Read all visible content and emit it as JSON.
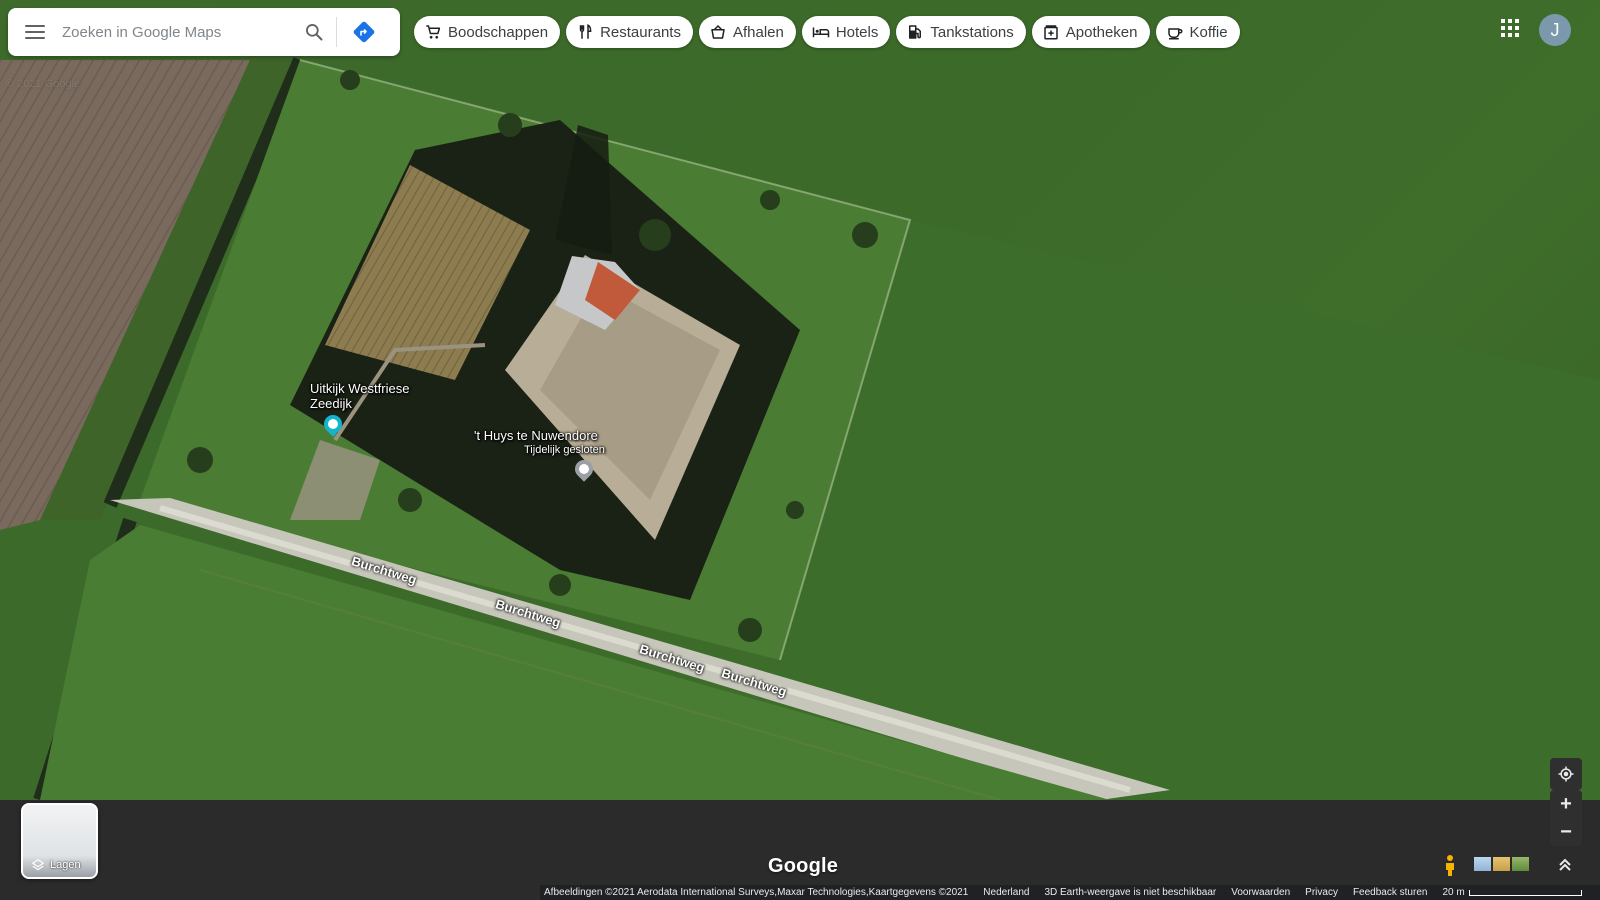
{
  "search": {
    "placeholder": "Zoeken in Google Maps",
    "menu_icon": "hamburger-menu-icon",
    "search_icon": "magnifier-icon",
    "directions_icon": "directions-diamond-icon",
    "accent_color": "#1a73e8"
  },
  "categories": [
    {
      "label": "Boodschappen",
      "icon": "shopping-cart-icon"
    },
    {
      "label": "Restaurants",
      "icon": "fork-knife-icon"
    },
    {
      "label": "Afhalen",
      "icon": "takeout-bag-icon"
    },
    {
      "label": "Hotels",
      "icon": "bed-icon"
    },
    {
      "label": "Tankstations",
      "icon": "fuel-pump-icon"
    },
    {
      "label": "Apotheken",
      "icon": "pharmacy-icon"
    },
    {
      "label": "Koffie",
      "icon": "coffee-cup-icon"
    }
  ],
  "account": {
    "initial": "J",
    "avatar_color": "#7b98ac"
  },
  "map": {
    "watermark": "© 2021 Google",
    "places": [
      {
        "name": "Uitkijk Westfriese Zeedijk",
        "name_line1": "Uitkijk Westfriese",
        "name_line2": "Zeedijk",
        "icon": "camera-pin-icon",
        "pin_color": "#12b5cb"
      },
      {
        "name": "'t Huys te Nuwendore",
        "status": "Tijdelijk gesloten",
        "icon": "museum-pin-icon",
        "pin_color": "#9aa0a6"
      }
    ],
    "roads": [
      "Burchtweg",
      "Burchtweg",
      "Burchtweg",
      "Burchtweg"
    ]
  },
  "controls": {
    "layers_label": "Lagen",
    "zoom_in": "+",
    "zoom_out": "−"
  },
  "branding": {
    "logo": "Google"
  },
  "footer": {
    "imagery": "Afbeeldingen ©2021 Aerodata International Surveys,Maxar Technologies,Kaartgegevens ©2021",
    "country": "Nederland",
    "earth_notice": "3D Earth-weergave is niet beschikbaar",
    "terms": "Voorwaarden",
    "privacy": "Privacy",
    "feedback": "Feedback sturen",
    "scale": "20 m"
  }
}
